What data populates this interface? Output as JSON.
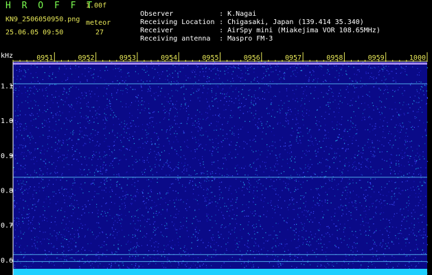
{
  "header": {
    "title": "H R O F F T",
    "version": "1.00f",
    "filename": "KN9_2506050950.png",
    "datetime": "25.06.05 09:50",
    "meteor_label": "meteor",
    "meteor_count": "27"
  },
  "info": [
    {
      "label": "Observer",
      "value": "K.Nagai"
    },
    {
      "label": "Receiving Location",
      "value": "Chigasaki, Japan (139.414 35.340)"
    },
    {
      "label": "Receiver",
      "value": "AirSpy mini (Miakejima VOR 108.65MHz)"
    },
    {
      "label": "Receiving antenna",
      "value": "Maspro FM-3"
    }
  ],
  "colors": {
    "background": "#000000",
    "spectrogram": "#0a0a88",
    "axis_text": "#ffffff",
    "time_ticks": "#e8e858",
    "signal_line": "#60d0ff",
    "noise_band": "#20d0ff"
  },
  "chart_data": {
    "type": "heatmap",
    "ylabel": "kHz",
    "y_ticks": [
      "1.1",
      "1.0",
      "0.9",
      "0.8",
      "0.7",
      "0.6"
    ],
    "x_ticks": [
      "0951",
      "0952",
      "0953",
      "0954",
      "0955",
      "0956",
      "0957",
      "0958",
      "0959",
      "1000"
    ],
    "xlim": [
      "0950",
      "1000"
    ],
    "ylim": [
      0.58,
      1.17
    ],
    "carrier_lines_khz": [
      1.163,
      1.105,
      0.837,
      0.615,
      0.595
    ]
  }
}
